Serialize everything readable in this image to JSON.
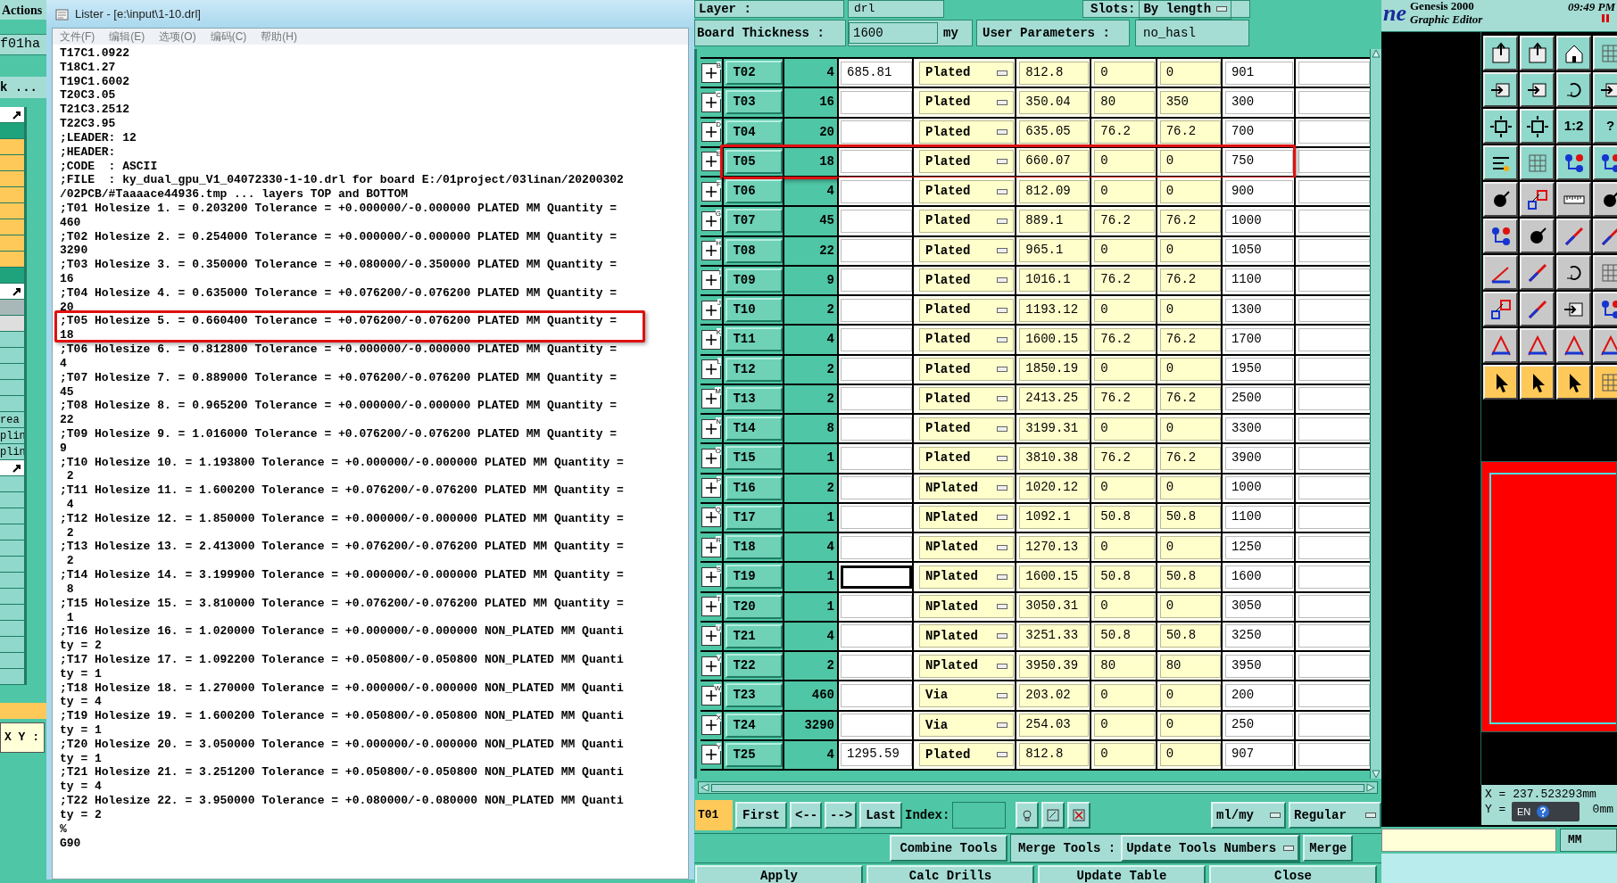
{
  "left_strip": {
    "menu": "Actions",
    "field": "f01ha",
    "row": "k ...",
    "labels": [
      "rea",
      "plin",
      "plin"
    ],
    "xy_label": "X Y :"
  },
  "lister": {
    "title": "Lister - [e:\\input\\1-10.drl]",
    "menu": [
      "文件(F)",
      "编辑(E)",
      "选项(O)",
      "编码(C)",
      "帮助(H)"
    ],
    "lines": [
      {
        "text": "T17C1.0922",
        "highlighted": false
      },
      {
        "text": "T18C1.27",
        "highlighted": false
      },
      {
        "text": "T19C1.6002",
        "highlighted": false
      },
      {
        "text": "T20C3.05",
        "highlighted": false
      },
      {
        "text": "T21C3.2512",
        "highlighted": false
      },
      {
        "text": "T22C3.95",
        "highlighted": false
      },
      {
        "text": ";LEADER: 12",
        "highlighted": false
      },
      {
        "text": ";HEADER:",
        "highlighted": false
      },
      {
        "text": ";CODE  : ASCII",
        "highlighted": false
      },
      {
        "text": ";FILE  : ky_dual_gpu_V1_04072330-1-10.drl for board E:/01project/03linan/20200302",
        "highlighted": false
      },
      {
        "text": "/02PCB/#Taaaace44936.tmp ... layers TOP and BOTTOM",
        "highlighted": false
      },
      {
        "text": ";T01 Holesize 1. = 0.203200 Tolerance = +0.000000/-0.000000 PLATED MM Quantity =",
        "highlighted": false
      },
      {
        "text": "460",
        "highlighted": false
      },
      {
        "text": ";T02 Holesize 2. = 0.254000 Tolerance = +0.000000/-0.000000 PLATED MM Quantity =",
        "highlighted": false
      },
      {
        "text": "3290",
        "highlighted": false
      },
      {
        "text": ";T03 Holesize 3. = 0.350000 Tolerance = +0.080000/-0.350000 PLATED MM Quantity =",
        "highlighted": false
      },
      {
        "text": "16",
        "highlighted": false
      },
      {
        "text": ";T04 Holesize 4. = 0.635000 Tolerance = +0.076200/-0.076200 PLATED MM Quantity =",
        "highlighted": false
      },
      {
        "text": "20",
        "highlighted": false
      },
      {
        "text": ";T05 Holesize 5. = 0.660400 Tolerance = +0.076200/-0.076200 PLATED MM Quantity =",
        "highlighted": true
      },
      {
        "text": "18",
        "highlighted": true
      },
      {
        "text": ";T06 Holesize 6. = 0.812800 Tolerance = +0.000000/-0.000000 PLATED MM Quantity =",
        "highlighted": false
      },
      {
        "text": "4",
        "highlighted": false
      },
      {
        "text": ";T07 Holesize 7. = 0.889000 Tolerance = +0.076200/-0.076200 PLATED MM Quantity =",
        "highlighted": false
      },
      {
        "text": "45",
        "highlighted": false
      },
      {
        "text": ";T08 Holesize 8. = 0.965200 Tolerance = +0.000000/-0.000000 PLATED MM Quantity =",
        "highlighted": false
      },
      {
        "text": "22",
        "highlighted": false
      },
      {
        "text": ";T09 Holesize 9. = 1.016000 Tolerance = +0.076200/-0.076200 PLATED MM Quantity =",
        "highlighted": false
      },
      {
        "text": "9",
        "highlighted": false
      },
      {
        "text": ";T10 Holesize 10. = 1.193800 Tolerance = +0.000000/-0.000000 PLATED MM Quantity =",
        "highlighted": false
      },
      {
        "text": " 2",
        "highlighted": false
      },
      {
        "text": ";T11 Holesize 11. = 1.600200 Tolerance = +0.076200/-0.076200 PLATED MM Quantity =",
        "highlighted": false
      },
      {
        "text": " 4",
        "highlighted": false
      },
      {
        "text": ";T12 Holesize 12. = 1.850000 Tolerance = +0.000000/-0.000000 PLATED MM Quantity =",
        "highlighted": false
      },
      {
        "text": " 2",
        "highlighted": false
      },
      {
        "text": ";T13 Holesize 13. = 2.413000 Tolerance = +0.076200/-0.076200 PLATED MM Quantity =",
        "highlighted": false
      },
      {
        "text": " 2",
        "highlighted": false
      },
      {
        "text": ";T14 Holesize 14. = 3.199900 Tolerance = +0.000000/-0.000000 PLATED MM Quantity =",
        "highlighted": false
      },
      {
        "text": " 8",
        "highlighted": false
      },
      {
        "text": ";T15 Holesize 15. = 3.810000 Tolerance = +0.076200/-0.076200 PLATED MM Quantity =",
        "highlighted": false
      },
      {
        "text": " 1",
        "highlighted": false
      },
      {
        "text": ";T16 Holesize 16. = 1.020000 Tolerance = +0.000000/-0.000000 NON_PLATED MM Quanti",
        "highlighted": false
      },
      {
        "text": "ty = 2",
        "highlighted": false
      },
      {
        "text": ";T17 Holesize 17. = 1.092200 Tolerance = +0.050800/-0.050800 NON_PLATED MM Quanti",
        "highlighted": false
      },
      {
        "text": "ty = 1",
        "highlighted": false
      },
      {
        "text": ";T18 Holesize 18. = 1.270000 Tolerance = +0.000000/-0.000000 NON_PLATED MM Quanti",
        "highlighted": false
      },
      {
        "text": "ty = 4",
        "highlighted": false
      },
      {
        "text": ";T19 Holesize 19. = 1.600200 Tolerance = +0.050800/-0.050800 NON_PLATED MM Quanti",
        "highlighted": false
      },
      {
        "text": "ty = 1",
        "highlighted": false
      },
      {
        "text": ";T20 Holesize 20. = 3.050000 Tolerance = +0.000000/-0.000000 NON_PLATED MM Quanti",
        "highlighted": false
      },
      {
        "text": "ty = 1",
        "highlighted": false
      },
      {
        "text": ";T21 Holesize 21. = 3.251200 Tolerance = +0.050800/-0.050800 NON_PLATED MM Quanti",
        "highlighted": false
      },
      {
        "text": "ty = 4",
        "highlighted": false
      },
      {
        "text": ";T22 Holesize 22. = 3.950000 Tolerance = +0.080000/-0.080000 NON_PLATED MM Quanti",
        "highlighted": false
      },
      {
        "text": "ty = 2",
        "highlighted": false
      },
      {
        "text": "%",
        "highlighted": false
      },
      {
        "text": "G90",
        "highlighted": false
      }
    ]
  },
  "drill_tools": {
    "layer_label": "Layer :",
    "layer": "drl",
    "slots_label": "Slots:",
    "slots": "By length",
    "thickness_label": "Board Thickness :",
    "thickness": "1600",
    "thickness_unit": "my",
    "params_label": "User Parameters :",
    "params": "no_hasl",
    "rows": [
      {
        "key": "B",
        "tool": "T02",
        "count": "4",
        "value_1": "685.81",
        "type": "Plated",
        "value_2": "812.8",
        "value_3": "0",
        "value_4": "0",
        "value_5": "901",
        "focused": false,
        "highlighted": false
      },
      {
        "key": "C",
        "tool": "T03",
        "count": "16",
        "type": "Plated",
        "value_2": "350.04",
        "value_3": "80",
        "value_4": "350",
        "value_5": "300",
        "focused": false,
        "highlighted": false
      },
      {
        "key": "D",
        "tool": "T04",
        "count": "20",
        "type": "Plated",
        "value_2": "635.05",
        "value_3": "76.2",
        "value_4": "76.2",
        "value_5": "700",
        "focused": false,
        "highlighted": false
      },
      {
        "key": "E",
        "tool": "T05",
        "count": "18",
        "type": "Plated",
        "value_2": "660.07",
        "value_3": "0",
        "value_4": "0",
        "value_5": "750",
        "focused": false,
        "highlighted": true
      },
      {
        "key": "F",
        "tool": "T06",
        "count": "4",
        "type": "Plated",
        "value_2": "812.09",
        "value_3": "0",
        "value_4": "0",
        "value_5": "900",
        "focused": false,
        "highlighted": false
      },
      {
        "key": "G",
        "tool": "T07",
        "count": "45",
        "type": "Plated",
        "value_2": "889.1",
        "value_3": "76.2",
        "value_4": "76.2",
        "value_5": "1000",
        "focused": false,
        "highlighted": false
      },
      {
        "key": "H",
        "tool": "T08",
        "count": "22",
        "type": "Plated",
        "value_2": "965.1",
        "value_3": "0",
        "value_4": "0",
        "value_5": "1050",
        "focused": false,
        "highlighted": false
      },
      {
        "key": "I",
        "tool": "T09",
        "count": "9",
        "type": "Plated",
        "value_2": "1016.1",
        "value_3": "76.2",
        "value_4": "76.2",
        "value_5": "1100",
        "focused": false,
        "highlighted": false
      },
      {
        "key": "J",
        "tool": "T10",
        "count": "2",
        "type": "Plated",
        "value_2": "1193.12",
        "value_3": "0",
        "value_4": "0",
        "value_5": "1300",
        "focused": false,
        "highlighted": false
      },
      {
        "key": "K",
        "tool": "T11",
        "count": "4",
        "type": "Plated",
        "value_2": "1600.15",
        "value_3": "76.2",
        "value_4": "76.2",
        "value_5": "1700",
        "focused": false,
        "highlighted": false
      },
      {
        "key": "L",
        "tool": "T12",
        "count": "2",
        "type": "Plated",
        "value_2": "1850.19",
        "value_3": "0",
        "value_4": "0",
        "value_5": "1950",
        "focused": false,
        "highlighted": false
      },
      {
        "key": "M",
        "tool": "T13",
        "count": "2",
        "type": "Plated",
        "value_2": "2413.25",
        "value_3": "76.2",
        "value_4": "76.2",
        "value_5": "2500",
        "focused": false,
        "highlighted": false
      },
      {
        "key": "N",
        "tool": "T14",
        "count": "8",
        "type": "Plated",
        "value_2": "3199.31",
        "value_3": "0",
        "value_4": "0",
        "value_5": "3300",
        "focused": false,
        "highlighted": false
      },
      {
        "key": "O",
        "tool": "T15",
        "count": "1",
        "type": "Plated",
        "value_2": "3810.38",
        "value_3": "76.2",
        "value_4": "76.2",
        "value_5": "3900",
        "focused": false,
        "highlighted": false
      },
      {
        "key": "P",
        "tool": "T16",
        "count": "2",
        "type": "NPlated",
        "value_2": "1020.12",
        "value_3": "0",
        "value_4": "0",
        "value_5": "1000",
        "focused": false,
        "highlighted": false
      },
      {
        "key": "Q",
        "tool": "T17",
        "count": "1",
        "type": "NPlated",
        "value_2": "1092.1",
        "value_3": "50.8",
        "value_4": "50.8",
        "value_5": "1100",
        "focused": false,
        "highlighted": false
      },
      {
        "key": "R",
        "tool": "T18",
        "count": "4",
        "type": "NPlated",
        "value_2": "1270.13",
        "value_3": "0",
        "value_4": "0",
        "value_5": "1250",
        "focused": false,
        "highlighted": false
      },
      {
        "key": "S",
        "tool": "T19",
        "count": "1",
        "type": "NPlated",
        "value_2": "1600.15",
        "value_3": "50.8",
        "value_4": "50.8",
        "value_5": "1600",
        "focused": true,
        "highlighted": false
      },
      {
        "key": "T",
        "tool": "T20",
        "count": "1",
        "type": "NPlated",
        "value_2": "3050.31",
        "value_3": "0",
        "value_4": "0",
        "value_5": "3050",
        "focused": false,
        "highlighted": false
      },
      {
        "key": "U",
        "tool": "T21",
        "count": "4",
        "type": "NPlated",
        "value_2": "3251.33",
        "value_3": "50.8",
        "value_4": "50.8",
        "value_5": "3250",
        "focused": false,
        "highlighted": false
      },
      {
        "key": "V",
        "tool": "T22",
        "count": "2",
        "type": "NPlated",
        "value_2": "3950.39",
        "value_3": "80",
        "value_4": "80",
        "value_5": "3950",
        "focused": false,
        "highlighted": false
      },
      {
        "key": "W",
        "tool": "T23",
        "count": "460",
        "type": "Via",
        "value_2": "203.02",
        "value_3": "0",
        "value_4": "0",
        "value_5": "200",
        "focused": false,
        "highlighted": false
      },
      {
        "key": "X",
        "tool": "T24",
        "count": "3290",
        "type": "Via",
        "value_2": "254.03",
        "value_3": "0",
        "value_4": "0",
        "value_5": "250",
        "focused": false,
        "highlighted": false
      },
      {
        "key": "Y",
        "tool": "T25",
        "count": "4",
        "value_1": "1295.59",
        "type": "Plated",
        "value_2": "812.8",
        "value_3": "0",
        "value_4": "0",
        "value_5": "907",
        "focused": false,
        "highlighted": false
      }
    ],
    "current_tool": "T01",
    "nav": [
      "First",
      "<--",
      "-->",
      "Last"
    ],
    "index_label": "Index:",
    "units": "ml/my",
    "mode": "Regular",
    "combine": "Combine Tools",
    "merge_label": "Merge Tools :",
    "merge_option": "Update Tools Numbers",
    "merge": "Merge",
    "actions": [
      "Apply",
      "Calc Drills",
      "Update Table",
      "Close"
    ]
  },
  "graphic_editor": {
    "logo": "ne",
    "title": "Genesis 2000",
    "subtitle": "Graphic Editor",
    "time": "09:49 PM",
    "toolbar_labels": [
      "1:2",
      "?"
    ],
    "coord_x": "X = 237.523293mm",
    "coord_y_start": "Y =",
    "coord_y_end": "0mm",
    "language": "EN",
    "units": "MM"
  }
}
